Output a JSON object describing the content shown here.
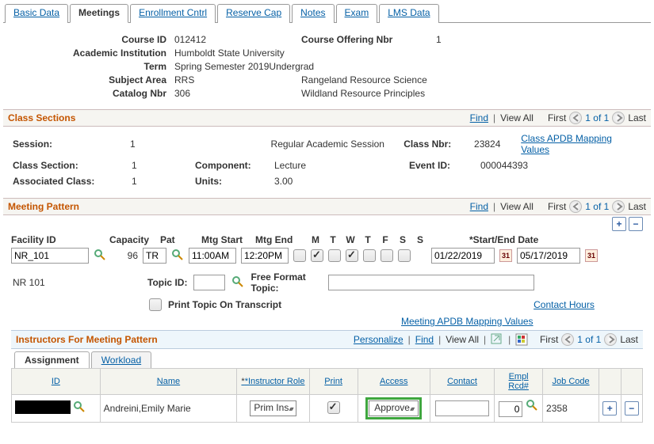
{
  "tabs": {
    "basic": "Basic Data",
    "meetings": "Meetings",
    "enroll": "Enrollment Cntrl",
    "reserve": "Reserve Cap",
    "notes": "Notes",
    "exam": "Exam",
    "lms": "LMS Data"
  },
  "header": {
    "courseid_lbl": "Course ID",
    "courseid": "012412",
    "offering_lbl": "Course Offering Nbr",
    "offering": "1",
    "inst_lbl": "Academic Institution",
    "inst": "Humboldt State University",
    "term_lbl": "Term",
    "term": "Spring Semester 2019Undergrad",
    "subj_lbl": "Subject Area",
    "subj": "RRS",
    "subj_desc": "Rangeland Resource Science",
    "cat_lbl": "Catalog Nbr",
    "cat": "306",
    "cat_desc": "Wildland Resource Principles"
  },
  "nav": {
    "find": "Find",
    "viewall": "View All",
    "first": "First",
    "count": "1 of 1",
    "last": "Last",
    "personalize": "Personalize"
  },
  "sections": {
    "class_sections": "Class Sections",
    "meeting_pattern": "Meeting Pattern",
    "instructors": "Instructors For Meeting Pattern"
  },
  "cs": {
    "session_lbl": "Session:",
    "session": "1",
    "session_desc": "Regular Academic Session",
    "classnbr_lbl": "Class Nbr:",
    "classnbr": "23824",
    "apdb_link": "Class APDB Mapping Values",
    "classsec_lbl": "Class Section:",
    "classsec": "1",
    "component_lbl": "Component:",
    "component": "Lecture",
    "eventid_lbl": "Event ID:",
    "eventid": "000044393",
    "assoc_lbl": "Associated Class:",
    "assoc": "1",
    "units_lbl": "Units:",
    "units": "3.00"
  },
  "mp": {
    "facility_lbl": "Facility ID",
    "capacity_lbl": "Capacity",
    "pat_lbl": "Pat",
    "mtgstart_lbl": "Mtg Start",
    "mtgend_lbl": "Mtg End",
    "days": {
      "M": "M",
      "T": "T",
      "W": "W",
      "T2": "T",
      "F": "F",
      "S": "S",
      "S2": "S"
    },
    "startend_lbl": "*Start/End Date",
    "facility_val": "NR_101",
    "capacity_val": "96",
    "pat_val": "TR",
    "mtgstart_val": "11:00AM",
    "mtgend_val": "12:20PM",
    "start_date": "01/22/2019",
    "end_date": "05/17/2019",
    "facility_desc": "NR  101",
    "topicid_lbl": "Topic ID:",
    "freeformat_lbl": "Free Format Topic:",
    "print_topic_lbl": "Print Topic On Transcript",
    "contact_hours": "Contact Hours",
    "meeting_apdb": "Meeting APDB Mapping Values"
  },
  "subtabs": {
    "assignment": "Assignment",
    "workload": "Workload"
  },
  "itab": {
    "h_id": "ID",
    "h_name": "Name",
    "h_role": "*Instructor Role",
    "h_print": "Print",
    "h_access": "Access",
    "h_contact": "Contact",
    "h_empl": "Empl Rcd#",
    "h_job": "Job Code"
  },
  "irow": {
    "name": "Andreini,Emily Marie",
    "role": "Prim Ins",
    "access": "Approve",
    "empl": "0",
    "job": "2358"
  }
}
